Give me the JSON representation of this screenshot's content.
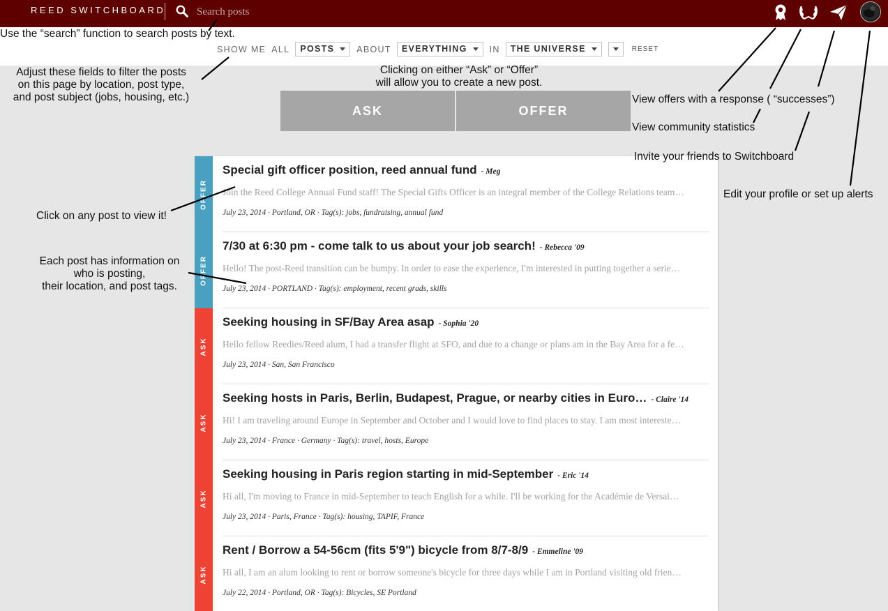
{
  "topbar": {
    "brand": "REED SWITCHBOARD",
    "search_placeholder": "Search posts",
    "icons": [
      "offers-icon",
      "successes-icon",
      "invite-icon",
      "profile-avatar"
    ]
  },
  "filters": {
    "show_me_label": "SHOW ME",
    "all_label": "ALL",
    "type_value": "POSTS",
    "about_label": "ABOUT",
    "subject_value": "EVERYTHING",
    "in_label": "IN",
    "location_value": "THE UNIVERSE",
    "reset_label": "RESET"
  },
  "actions": {
    "ask_label": "ASK",
    "offer_label": "OFFER"
  },
  "colors": {
    "topbar": "#5f0000",
    "offer": "#4aa0c0",
    "ask": "#ee4234",
    "action_button": "#a6a6a6"
  },
  "posts": [
    {
      "type": "OFFER",
      "title": "Special gift officer position, reed annual fund",
      "author": "- Meg",
      "excerpt": "Join the Reed College Annual Fund staff! The Special Gifts Officer is an integral member of the College Relations team…",
      "meta": "July 23, 2014 · Portland, OR · Tag(s): jobs, fundraising, annual fund"
    },
    {
      "type": "OFFER",
      "title": "7/30 at 6:30 pm - come talk to us about your job search!",
      "author": "- Rebecca '09",
      "excerpt": "Hello! The post-Reed transition can be bumpy. In order to ease the experience, I'm interested in putting together a serie…",
      "meta": "July 23, 2014 · PORTLAND · Tag(s): employment, recent grads, skills"
    },
    {
      "type": "ASK",
      "title": "Seeking housing in SF/Bay Area asap",
      "author": "- Sophia '20",
      "excerpt": "Hello fellow Reedies/Reed alum, I had a transfer flight at SFO, and due to a change or plans am in the Bay Area for a fe…",
      "meta": "July 23, 2014 · San, San Francisco"
    },
    {
      "type": "ASK",
      "title": "Seeking hosts in Paris, Berlin, Budapest, Prague, or nearby cities in Euro…",
      "author": "- Claire '14",
      "excerpt": "Hi! I am traveling around Europe in September and October and I would love to find places to stay. I am most intereste…",
      "meta": "July 23, 2014 · France · Germany · Tag(s): travel, hosts, Europe"
    },
    {
      "type": "ASK",
      "title": "Seeking housing in Paris region starting in mid-September",
      "author": "- Eric '14",
      "excerpt": "Hi all, I'm moving to France in mid-September to teach English for a while. I'll be working for the Académie de Versai…",
      "meta": "July 23, 2014 · Paris, France · Tag(s): housing, TAPIF, France"
    },
    {
      "type": "ASK",
      "title": "Rent / Borrow a 54-56cm (fits 5'9\") bicycle from 8/7-8/9",
      "author": "- Emmeline '09",
      "excerpt": "Hi all, I am an alum looking to rent or borrow someone's bicycle for three days while I am in Portland visiting old frien…",
      "meta": "July 22, 2014 · Portland, OR · Tag(s): Bicycles, SE Portland"
    }
  ],
  "annotations": {
    "search": "Use the “search” function to search posts by text.",
    "filters": [
      "Adjust these fields to filter the posts",
      "on this page by location, post type,",
      "and post subject (jobs, housing, etc.)"
    ],
    "create": [
      "Clicking on either “Ask” or “Offer”",
      "will allow you to create a new post."
    ],
    "offers": "View offers with a response ( “successes”)",
    "stats": "View community statistics",
    "invite": "Invite your friends to Switchboard",
    "profile": "Edit your profile or set up alerts",
    "click_post": "Click on any post to view it!",
    "post_info": [
      "Each post has information on",
      "who is posting,",
      "their location, and post tags."
    ]
  }
}
